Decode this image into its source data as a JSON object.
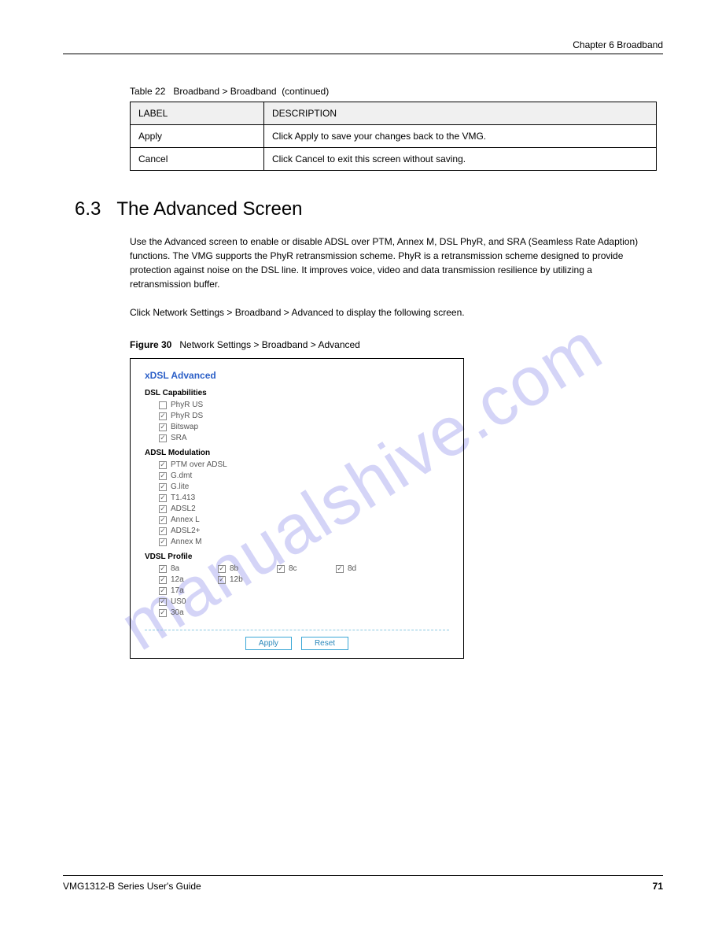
{
  "header": {
    "chapter": "Chapter 6 Broadband",
    "continued": "(continued)"
  },
  "table": {
    "caption_label": "Table 22",
    "caption_text": "Broadband > Broadband",
    "headers": [
      "LABEL",
      "DESCRIPTION"
    ],
    "rows": [
      [
        "Apply",
        "Click Apply to save your changes back to the VMG."
      ],
      [
        "Cancel",
        "Click Cancel to exit this screen without saving."
      ]
    ]
  },
  "section": {
    "number": "6.3",
    "title": "The Advanced Screen"
  },
  "paragraphs": {
    "p1": "Use the Advanced screen to enable or disable ADSL over PTM, Annex M, DSL PhyR, and SRA (Seamless Rate Adaption) functions. The VMG supports the PhyR retransmission scheme. PhyR is a retransmission scheme designed to provide protection against noise on the DSL line. It improves voice, video and data transmission resilience by utilizing a retransmission buffer.",
    "p2_href": "Click Network Settings > Broadband > Advanced",
    "p2_rest": " to display the following screen."
  },
  "figure": {
    "label": "Figure 30",
    "text": "Network Settings > Broadband > Advanced"
  },
  "panel": {
    "title": "xDSL Advanced",
    "groups": {
      "dsl": {
        "title": "DSL Capabilities",
        "items": [
          {
            "label": "PhyR US",
            "checked": false
          },
          {
            "label": "PhyR DS",
            "checked": true
          },
          {
            "label": "Bitswap",
            "checked": true
          },
          {
            "label": "SRA",
            "checked": true
          }
        ]
      },
      "adsl": {
        "title": "ADSL Modulation",
        "items": [
          {
            "label": "PTM over ADSL",
            "checked": true
          },
          {
            "label": "G.dmt",
            "checked": true
          },
          {
            "label": "G.lite",
            "checked": true
          },
          {
            "label": "T1.413",
            "checked": true
          },
          {
            "label": "ADSL2",
            "checked": true
          },
          {
            "label": "Annex L",
            "checked": true
          },
          {
            "label": "ADSL2+",
            "checked": true
          },
          {
            "label": "Annex M",
            "checked": true
          }
        ]
      },
      "vdsl": {
        "title": "VDSL Profile",
        "rows": [
          [
            {
              "label": "8a",
              "checked": true
            },
            {
              "label": "8b",
              "checked": true
            },
            {
              "label": "8c",
              "checked": true
            },
            {
              "label": "8d",
              "checked": true
            }
          ],
          [
            {
              "label": "12a",
              "checked": true
            },
            {
              "label": "12b",
              "checked": true
            }
          ],
          [
            {
              "label": "17a",
              "checked": true
            }
          ],
          [
            {
              "label": "US0",
              "checked": true
            }
          ],
          [
            {
              "label": "30a",
              "checked": true
            }
          ]
        ]
      }
    },
    "buttons": {
      "apply": "Apply",
      "reset": "Reset"
    }
  },
  "footer": {
    "doc": "VMG1312-B Series User's Guide",
    "page": "71"
  },
  "watermark": "manualshive.com"
}
